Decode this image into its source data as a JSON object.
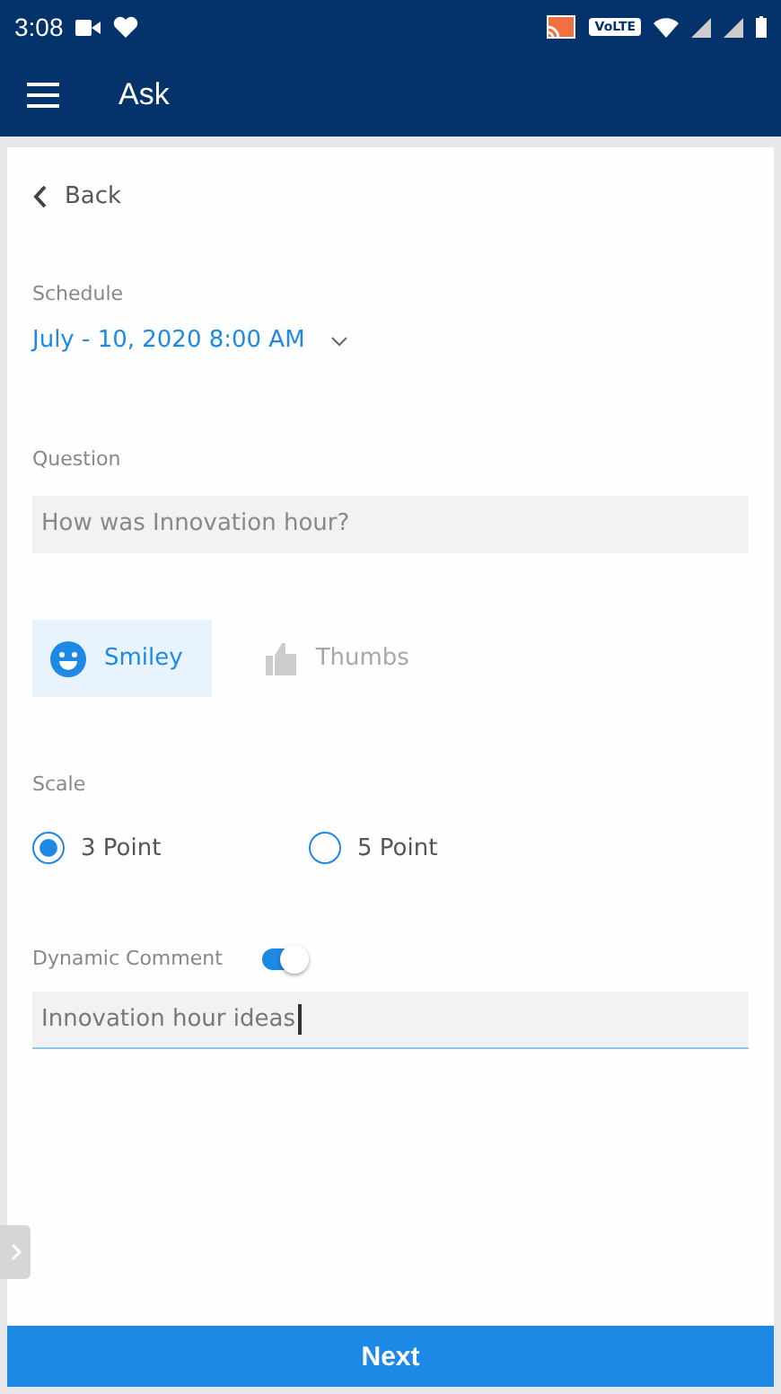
{
  "status_bar": {
    "time": "3:08",
    "network": "VoLTE"
  },
  "app_bar": {
    "title": "Ask"
  },
  "back": {
    "label": "Back"
  },
  "schedule": {
    "label": "Schedule",
    "value": "July - 10, 2020 8:00 AM"
  },
  "question": {
    "label": "Question",
    "value": "How was Innovation hour?"
  },
  "response_types": [
    {
      "label": "Smiley",
      "kind": "smiley",
      "selected": true
    },
    {
      "label": "Thumbs",
      "kind": "thumbs",
      "selected": false
    }
  ],
  "scale": {
    "label": "Scale",
    "options": [
      {
        "label": "3 Point",
        "selected": true
      },
      {
        "label": "5 Point",
        "selected": false
      }
    ]
  },
  "dynamic_comment": {
    "label": "Dynamic Comment",
    "on": true,
    "value": "Innovation hour ideas",
    "focused": true
  },
  "next_button": "Next"
}
